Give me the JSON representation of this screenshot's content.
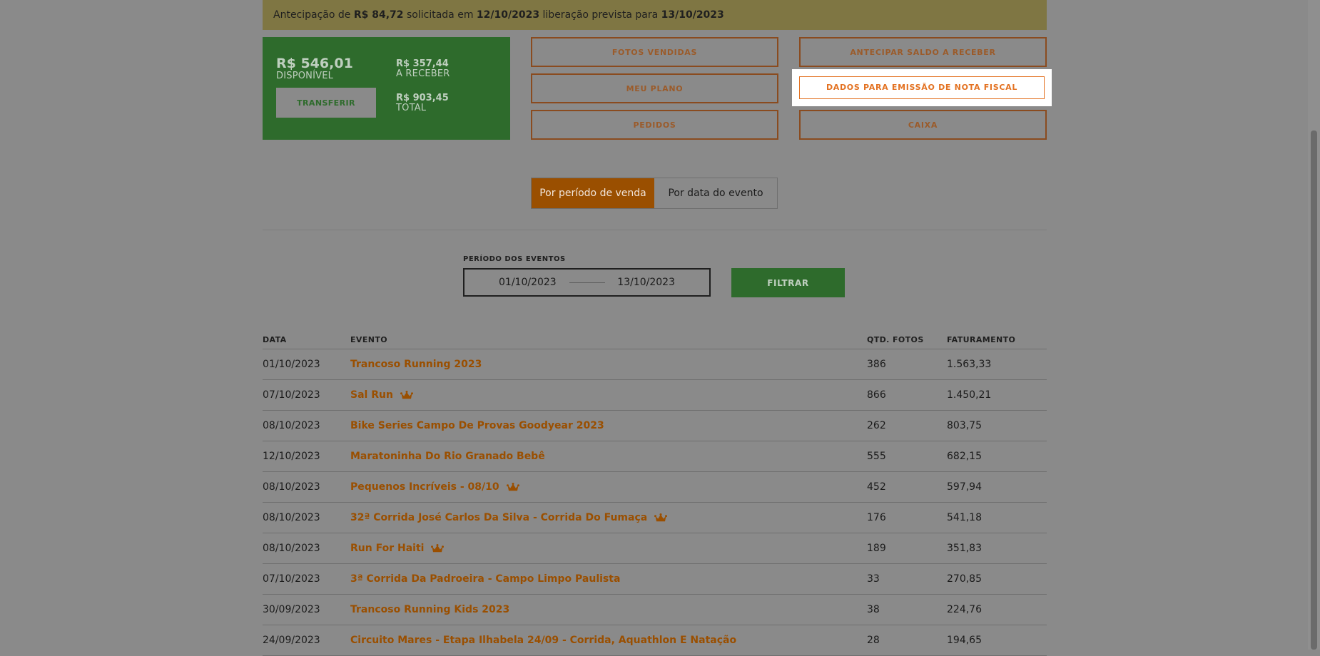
{
  "notice": {
    "prefix": "Antecipação de ",
    "amount": "R$ 84,72",
    "middle": " solicitada em ",
    "date": "12/10/2023",
    "suffix": " liberação prevista para ",
    "release": "13/10/2023"
  },
  "balance": {
    "available_amount": "R$ 546,01",
    "available_label": "DISPONÍVEL",
    "transfer_label": "TRANSFERIR",
    "receivable_amount": "R$ 357,44",
    "receivable_label": "A RECEBER",
    "total_amount": "R$ 903,45",
    "total_label": "TOTAL"
  },
  "actions": {
    "fotos_vendidas": "FOTOS VENDIDAS",
    "meu_plano": "MEU PLANO",
    "pedidos": "PEDIDOS",
    "antecipar": "ANTECIPAR SALDO A RECEBER",
    "nota_fiscal": "DADOS PARA EMISSÃO DE NOTA FISCAL",
    "caixa": "CAIXA"
  },
  "toggle": {
    "option1": "Por período de venda",
    "option2": "Por data do evento"
  },
  "filter": {
    "label": "PERÍODO DOS EVENTOS",
    "start": "01/10/2023",
    "end": "13/10/2023",
    "button": "FILTRAR"
  },
  "table": {
    "headers": {
      "date": "DATA",
      "event": "EVENTO",
      "qty": "QTD. FOTOS",
      "revenue": "FATURAMENTO"
    },
    "rows": [
      {
        "date": "01/10/2023",
        "event": "Trancoso Running 2023",
        "qty": "386",
        "revenue": "1.563,33",
        "crown": false
      },
      {
        "date": "07/10/2023",
        "event": "Sal Run",
        "qty": "866",
        "revenue": "1.450,21",
        "crown": true
      },
      {
        "date": "08/10/2023",
        "event": "Bike Series Campo De Provas Goodyear 2023",
        "qty": "262",
        "revenue": "803,75",
        "crown": false
      },
      {
        "date": "12/10/2023",
        "event": "Maratoninha Do Rio Granado Bebê",
        "qty": "555",
        "revenue": "682,15",
        "crown": false
      },
      {
        "date": "08/10/2023",
        "event": "Pequenos Incríveis - 08/10",
        "qty": "452",
        "revenue": "597,94",
        "crown": true
      },
      {
        "date": "08/10/2023",
        "event": "32ª Corrida José Carlos Da Silva - Corrida Do Fumaça",
        "qty": "176",
        "revenue": "541,18",
        "crown": true
      },
      {
        "date": "08/10/2023",
        "event": "Run For Haiti",
        "qty": "189",
        "revenue": "351,83",
        "crown": true
      },
      {
        "date": "07/10/2023",
        "event": "3ª Corrida Da Padroeira - Campo Limpo Paulista",
        "qty": "33",
        "revenue": "270,85",
        "crown": false
      },
      {
        "date": "30/09/2023",
        "event": "Trancoso Running Kids 2023",
        "qty": "38",
        "revenue": "224,76",
        "crown": false
      },
      {
        "date": "24/09/2023",
        "event": "Circuito Mares - Etapa Ilhabela 24/09 - Corrida, Aquathlon E Natação",
        "qty": "28",
        "revenue": "194,65",
        "crown": false
      }
    ]
  }
}
